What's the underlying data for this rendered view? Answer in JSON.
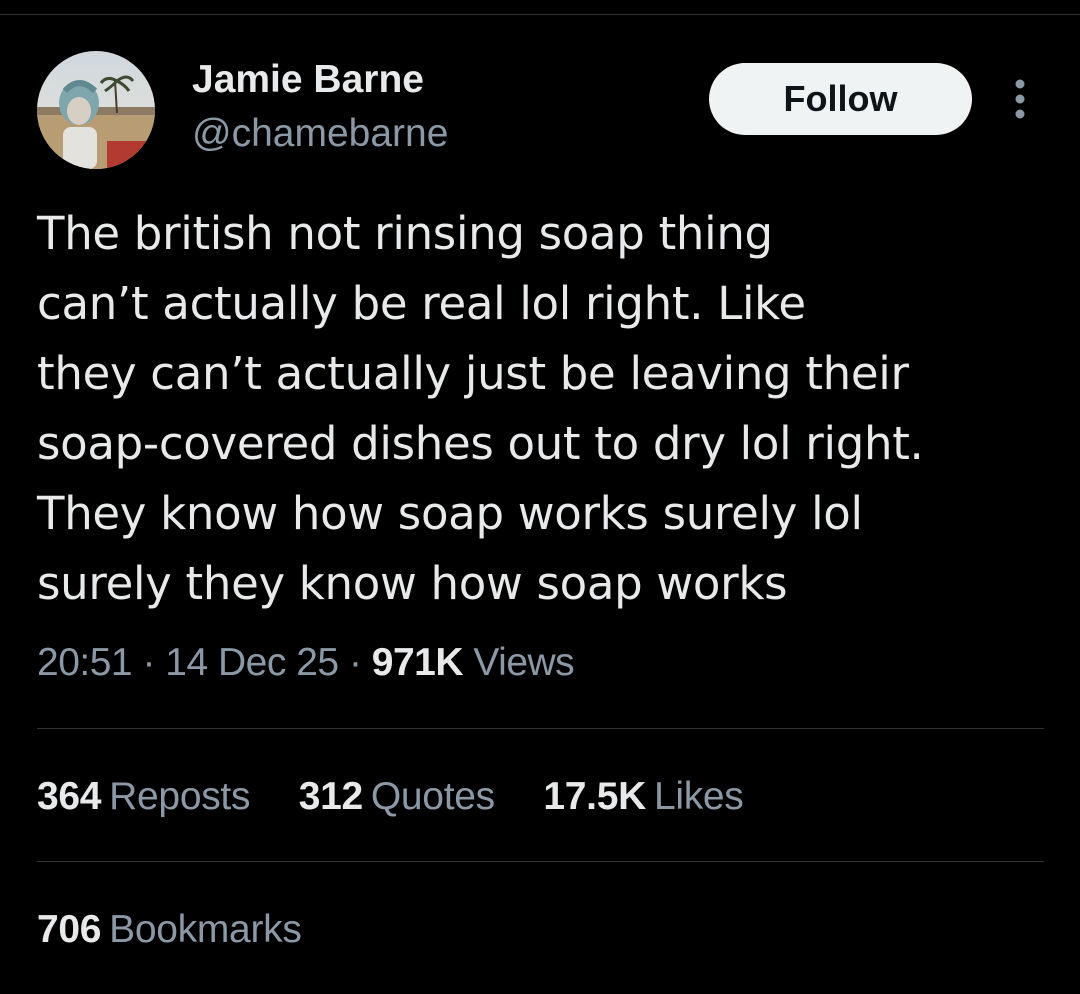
{
  "author": {
    "display_name": "Jamie Barne",
    "handle": "@chamebarne",
    "avatar_icon": "profile-photo"
  },
  "follow_label": "Follow",
  "more_icon": "more-vertical-icon",
  "tweet": {
    "lines": [
      "The british not rinsing soap thing",
      "can’t actually be real lol right. Like",
      "they can’t actually just be leaving their",
      "soap-covered dishes out to dry lol right.",
      "They know how soap works surely lol",
      "surely they know how soap works"
    ]
  },
  "meta": {
    "time": "20:51",
    "separator": "·",
    "date": "14 Dec 25",
    "views_count": "971K",
    "views_label": "Views"
  },
  "stats": {
    "reposts_count": "364",
    "reposts_label": "Reposts",
    "quotes_count": "312",
    "quotes_label": "Quotes",
    "likes_count": "17.5K",
    "likes_label": "Likes",
    "bookmarks_count": "706",
    "bookmarks_label": "Bookmarks"
  },
  "colors": {
    "background": "#000000",
    "text_primary": "#e7e9ea",
    "text_secondary": "#8b98a5",
    "divider": "#2f3336",
    "follow_bg": "#eff3f4"
  }
}
